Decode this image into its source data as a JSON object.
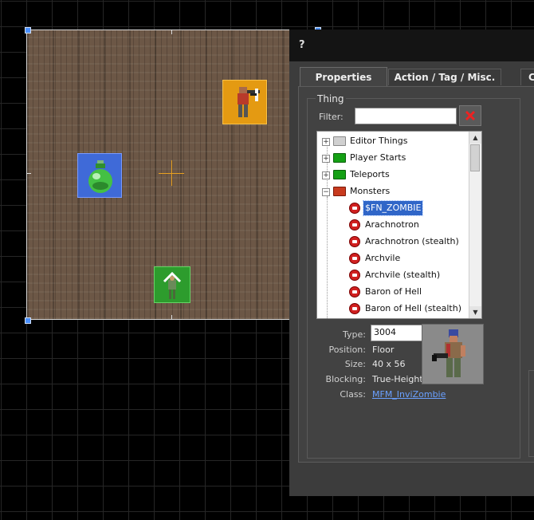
{
  "dialog": {
    "title": "?",
    "tabs": [
      {
        "label": "Properties"
      },
      {
        "label": "Action / Tag / Misc."
      },
      {
        "label": "C"
      }
    ]
  },
  "thing_group": {
    "title": "Thing",
    "filter_label": "Filter:",
    "filter_value": ""
  },
  "tree": {
    "categories": [
      {
        "label": "Editor Things",
        "expander": "+"
      },
      {
        "label": "Player Starts",
        "expander": "+"
      },
      {
        "label": "Teleports",
        "expander": "+"
      },
      {
        "label": "Monsters",
        "expander": "−"
      }
    ],
    "monsters": [
      {
        "label": "$FN_ZOMBIE",
        "selected": true
      },
      {
        "label": "Arachnotron"
      },
      {
        "label": "Arachnotron (stealth)"
      },
      {
        "label": "Archvile"
      },
      {
        "label": "Archvile (stealth)"
      },
      {
        "label": "Baron of Hell"
      },
      {
        "label": "Baron of Hell (stealth)"
      }
    ]
  },
  "info": {
    "type_label": "Type:",
    "type_value": "3004",
    "position_label": "Position:",
    "position_value": "Floor",
    "size_label": "Size:",
    "size_value": "40 x 56",
    "blocking_label": "Blocking:",
    "blocking_value": "True-Height",
    "class_label": "Class:",
    "class_value": "MFM_InviZombie"
  },
  "colors": {
    "selection": "#3066c8",
    "crosshair": "#e8a020",
    "folder_green": "#14a014",
    "folder_open_red": "#c83a1e",
    "folder_gray": "#c8c8c8"
  },
  "icons": {
    "clear": "red-x-icon",
    "monster": "monster-icon",
    "folder": "folder-icon"
  }
}
